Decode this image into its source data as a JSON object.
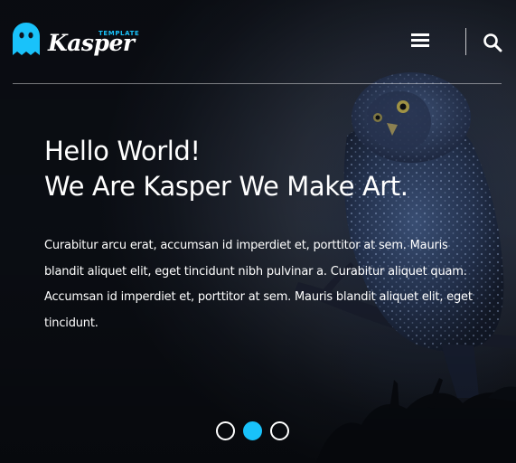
{
  "logo": {
    "icon": "ghost-icon",
    "small_text": "TEMPLATE",
    "wordmark": "Kasper",
    "accent_color": "#19c2fa"
  },
  "header": {
    "menu_icon": "hamburger-menu-icon",
    "search_icon": "search-icon"
  },
  "hero": {
    "background": "owl-on-branch-photo",
    "heading_line1": "Hello World!",
    "heading_line2": "We Are Kasper We Make Art.",
    "paragraph": "Curabitur arcu erat, accumsan id imperdiet et, porttitor at sem. Mauris blandit aliquet elit, eget tincidunt nibh pulvinar a. Curabitur aliquet quam. Accumsan id imperdiet et, porttitor at sem. Mauris blandit aliquet elit, eget tincidunt."
  },
  "slider": {
    "bullet_count": 3,
    "active_index": 1
  }
}
